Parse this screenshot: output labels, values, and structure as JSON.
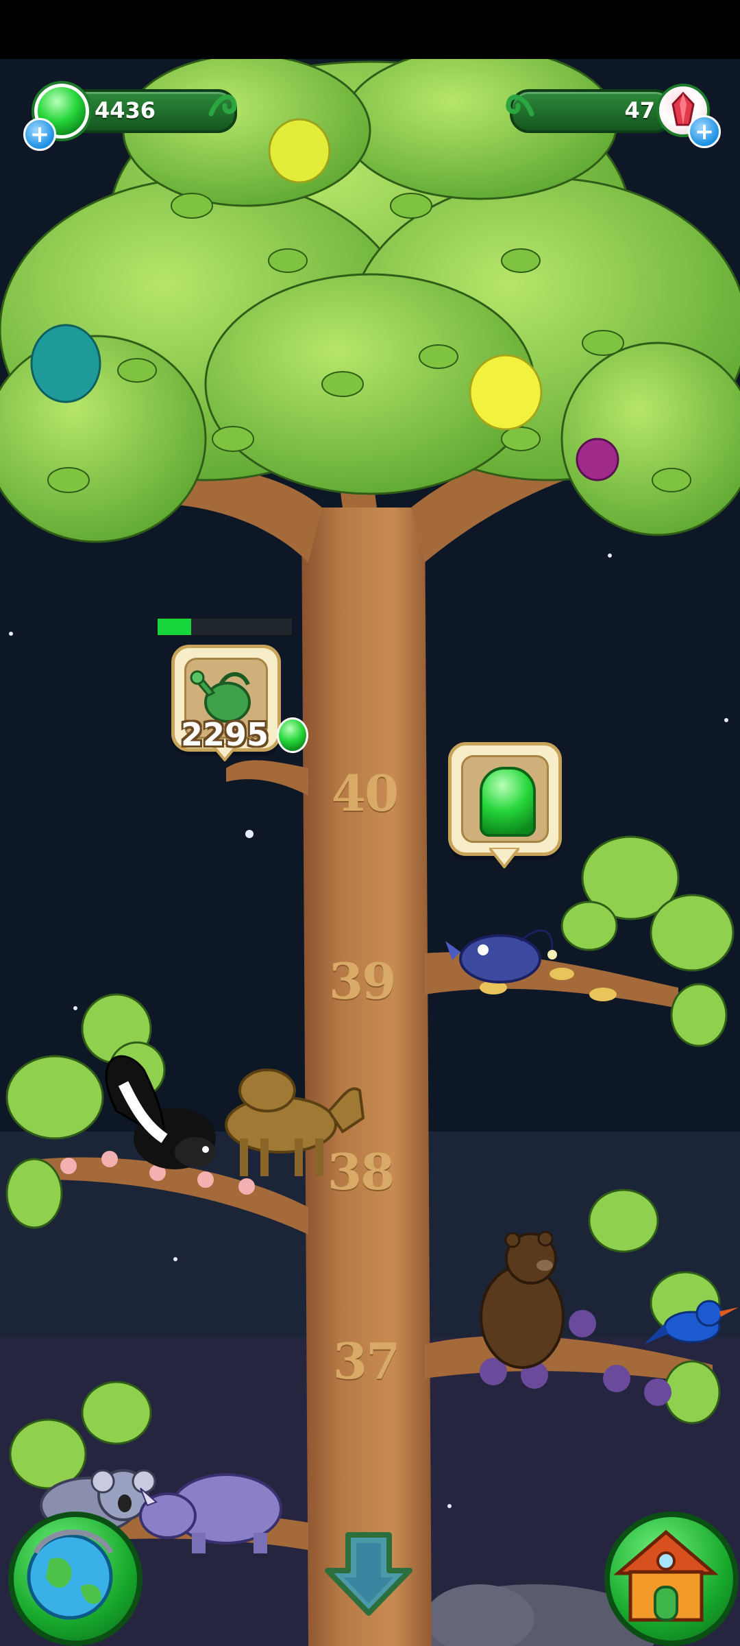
{
  "hud": {
    "jelly_count": "4436",
    "gem_count": "47",
    "plus_symbol": "+"
  },
  "task": {
    "cost": "2295",
    "icon": "watering-can-icon",
    "progress_fraction": 0.25
  },
  "levels": [
    "40",
    "39",
    "38",
    "37"
  ],
  "reward_icon": "jelly-icon",
  "buttons": {
    "left": "globe-icon",
    "right": "house-icon",
    "center": "down-arrow-icon"
  },
  "colors": {
    "sky": "#0d1726",
    "trunk": "#a56a3a",
    "leaf": "#8fd14f",
    "jelly_green": "#26d63a",
    "gem_red": "#e23a4a"
  }
}
